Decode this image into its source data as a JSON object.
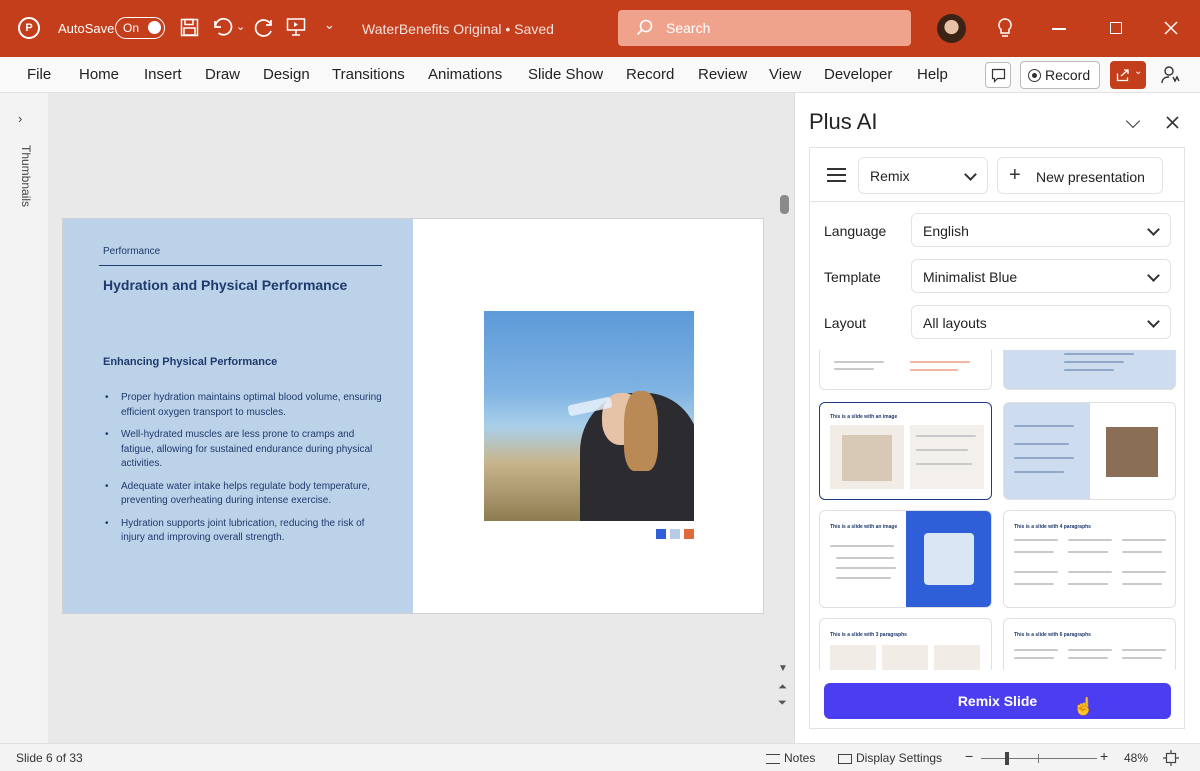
{
  "titlebar": {
    "autosave_label": "AutoSave",
    "autosave_state": "On",
    "doc_title": "WaterBenefits Original • Saved",
    "search_placeholder": "Search"
  },
  "ribbon": {
    "tabs": [
      "File",
      "Home",
      "Insert",
      "Draw",
      "Design",
      "Transitions",
      "Animations",
      "Slide Show",
      "Record",
      "Review",
      "View",
      "Developer",
      "Help"
    ],
    "record_label": "Record"
  },
  "thumbnails_label": "Thumbnails",
  "slide": {
    "section": "Performance",
    "title": "Hydration and Physical Performance",
    "subtitle": "Enhancing Physical Performance",
    "bullets": [
      "Proper hydration maintains optimal blood volume, ensuring efficient oxygen transport to muscles.",
      "Well-hydrated muscles are less prone to cramps and fatigue, allowing for sustained endurance during physical activities.",
      "Adequate water intake helps regulate body temperature, preventing overheating during intense exercise.",
      "Hydration supports joint lubrication, reducing the risk of injury and improving overall strength."
    ],
    "dot_colors": [
      "#2f5fd8",
      "#b9cbe6",
      "#e06a3b"
    ]
  },
  "plus_ai": {
    "title": "Plus AI",
    "mode": "Remix",
    "new_presentation": "New presentation",
    "language_label": "Language",
    "language_value": "English",
    "template_label": "Template",
    "template_value": "Minimalist Blue",
    "layout_label": "Layout",
    "layout_value": "All layouts",
    "cards": {
      "image_title": "This is a slide with an image",
      "three_para_title": "This is a slide with 3 paragraphs",
      "four_para_title": "This is a slide with 4 paragraphs",
      "six_para_title": "This is a slide with 6 paragraphs"
    },
    "remix_button": "Remix Slide",
    "accent": "#4a3ef0"
  },
  "statusbar": {
    "slide_counter": "Slide 6 of 33",
    "notes": "Notes",
    "display_settings": "Display Settings",
    "zoom": "48%"
  }
}
